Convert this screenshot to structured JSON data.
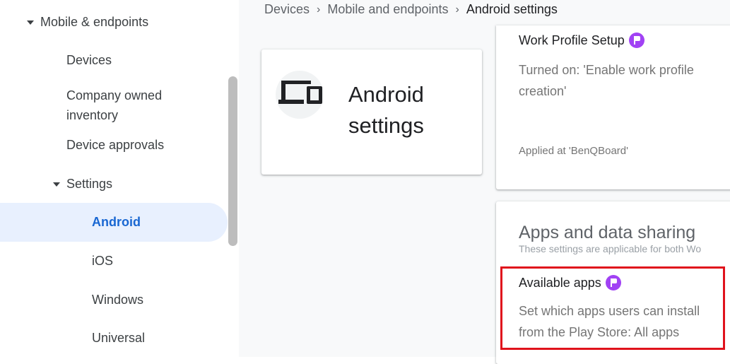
{
  "sidebar": {
    "mobile_endpoints": "Mobile & endpoints",
    "devices": "Devices",
    "company_owned_line1": "Company owned",
    "company_owned_line2": "inventory",
    "device_approvals": "Device approvals",
    "settings": "Settings",
    "android": "Android",
    "ios": "iOS",
    "windows": "Windows",
    "universal": "Universal"
  },
  "breadcrumb": {
    "items": [
      "Devices",
      "Mobile and endpoints",
      "Android settings"
    ],
    "separator": "›"
  },
  "title_card": {
    "title_line1": "Android",
    "title_line2": "settings",
    "icon": "devices-icon"
  },
  "work_profile": {
    "title": "Work Profile Setup",
    "description": "Turned on: 'Enable work profile creation'",
    "applied": "Applied at 'BenQBoard'"
  },
  "apps_sharing": {
    "heading": "Apps and data sharing",
    "subheading": "These settings are applicable for both Wo",
    "available_title": "Available apps",
    "available_description": "Set which apps users can install from the Play Store: All apps"
  },
  "colors": {
    "accent": "#1967d2",
    "active_bg": "#e8f0fe",
    "badge": "#a142f4",
    "highlight": "#e0121c"
  }
}
